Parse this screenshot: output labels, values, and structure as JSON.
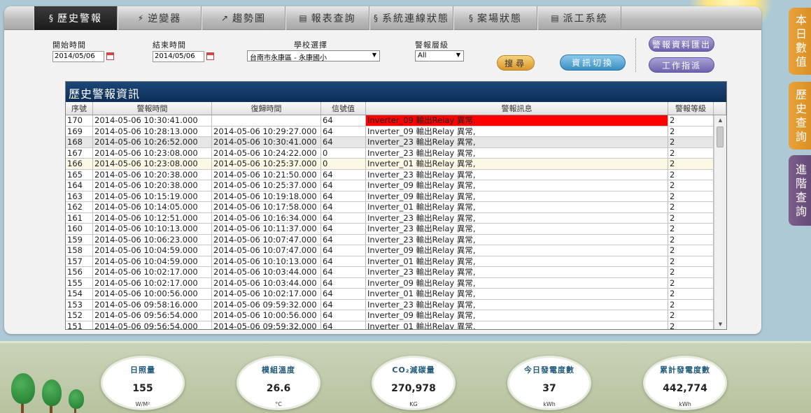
{
  "nav": {
    "tabs": [
      {
        "icon": "§",
        "label": "歷史警報"
      },
      {
        "icon": "⚡",
        "label": "逆變器"
      },
      {
        "icon": "↗",
        "label": "趨勢圖"
      },
      {
        "icon": "▤",
        "label": "報表查詢"
      },
      {
        "icon": "§",
        "label": "系統連線狀態"
      },
      {
        "icon": "§",
        "label": "案場狀態"
      },
      {
        "icon": "▤",
        "label": "派工系統"
      }
    ]
  },
  "filters": {
    "start_label": "開始時間",
    "start_value": "2014/05/06",
    "end_label": "結束時間",
    "end_value": "2014/05/06",
    "school_label": "學校選擇",
    "school_value": "台南市永康區 - 永康國小",
    "level_label": "警報層級",
    "level_value": "All",
    "search_button": "搜尋",
    "switch_button": "資訊切換",
    "export_button": "警報資料匯出",
    "work_button": "工作指派"
  },
  "table": {
    "title": "歷史警報資訊",
    "headers": [
      "序號",
      "警報時間",
      "復歸時間",
      "信號值",
      "警報訊息",
      "警報等級"
    ],
    "rows": [
      [
        "170",
        "2014-05-06 10:30:41.000",
        "",
        "64",
        "Inverter_09 輸出Relay 異常,",
        "2"
      ],
      [
        "169",
        "2014-05-06 10:28:13.000",
        "2014-05-06 10:29:27.000",
        "64",
        "Inverter_09 輸出Relay 異常,",
        "2"
      ],
      [
        "168",
        "2014-05-06 10:26:52.000",
        "2014-05-06 10:30:41.000",
        "64",
        "Inverter_23 輸出Relay 異常,",
        "2"
      ],
      [
        "167",
        "2014-05-06 10:23:08.000",
        "2014-05-06 10:24:22.000",
        "0",
        "Inverter_23 輸出Relay 異常,",
        "2"
      ],
      [
        "166",
        "2014-05-06 10:23:08.000",
        "2014-05-06 10:25:37.000",
        "0",
        "Inverter_01 輸出Relay 異常,",
        "2"
      ],
      [
        "165",
        "2014-05-06 10:20:38.000",
        "2014-05-06 10:21:50.000",
        "64",
        "Inverter_23 輸出Relay 異常,",
        "2"
      ],
      [
        "164",
        "2014-05-06 10:20:38.000",
        "2014-05-06 10:25:37.000",
        "64",
        "Inverter_09 輸出Relay 異常,",
        "2"
      ],
      [
        "163",
        "2014-05-06 10:15:19.000",
        "2014-05-06 10:19:18.000",
        "64",
        "Inverter_09 輸出Relay 異常,",
        "2"
      ],
      [
        "162",
        "2014-05-06 10:14:05.000",
        "2014-05-06 10:17:58.000",
        "64",
        "Inverter_01 輸出Relay 異常,",
        "2"
      ],
      [
        "161",
        "2014-05-06 10:12:51.000",
        "2014-05-06 10:16:34.000",
        "64",
        "Inverter_23 輸出Relay 異常,",
        "2"
      ],
      [
        "160",
        "2014-05-06 10:10:13.000",
        "2014-05-06 10:11:37.000",
        "64",
        "Inverter_23 輸出Relay 異常,",
        "2"
      ],
      [
        "159",
        "2014-05-06 10:06:23.000",
        "2014-05-06 10:07:47.000",
        "64",
        "Inverter_23 輸出Relay 異常,",
        "2"
      ],
      [
        "158",
        "2014-05-06 10:04:59.000",
        "2014-05-06 10:07:47.000",
        "64",
        "Inverter_09 輸出Relay 異常,",
        "2"
      ],
      [
        "157",
        "2014-05-06 10:04:59.000",
        "2014-05-06 10:10:13.000",
        "64",
        "Inverter_01 輸出Relay 異常,",
        "2"
      ],
      [
        "156",
        "2014-05-06 10:02:17.000",
        "2014-05-06 10:03:44.000",
        "64",
        "Inverter_23 輸出Relay 異常,",
        "2"
      ],
      [
        "155",
        "2014-05-06 10:02:17.000",
        "2014-05-06 10:03:44.000",
        "64",
        "Inverter_09 輸出Relay 異常,",
        "2"
      ],
      [
        "154",
        "2014-05-06 10:00:56.000",
        "2014-05-06 10:02:17.000",
        "64",
        "Inverter_01 輸出Relay 異常,",
        "2"
      ],
      [
        "153",
        "2014-05-06 09:58:16.000",
        "2014-05-06 09:59:32.000",
        "64",
        "Inverter_23 輸出Relay 異常,",
        "2"
      ],
      [
        "152",
        "2014-05-06 09:56:54.000",
        "2014-05-06 10:00:56.000",
        "64",
        "Inverter_09 輸出Relay 異常,",
        "2"
      ],
      [
        "151",
        "2014-05-06 09:56:54.000",
        "2014-05-06 09:59:32.000",
        "64",
        "Inverter_01 輸出Relay 異常,",
        "2"
      ]
    ],
    "alert_color": "#ff0000"
  },
  "side_tabs": [
    {
      "chars": [
        "本",
        "日",
        "數",
        "值"
      ]
    },
    {
      "chars": [
        "歷",
        "史",
        "查",
        "詢"
      ]
    },
    {
      "chars": [
        "進",
        "階",
        "查",
        "詢"
      ]
    }
  ],
  "gauges": [
    {
      "label": "日照量",
      "value": "155",
      "unit": "W/M²"
    },
    {
      "label": "模組溫度",
      "value": "26.6",
      "unit": "°C"
    },
    {
      "label": "CO₂減碳量",
      "value": "270,978",
      "unit": "KG"
    },
    {
      "label": "今日發電度數",
      "value": "37",
      "unit": "kWh"
    },
    {
      "label": "累計發電度數",
      "value": "442,774",
      "unit": "kWh"
    }
  ]
}
